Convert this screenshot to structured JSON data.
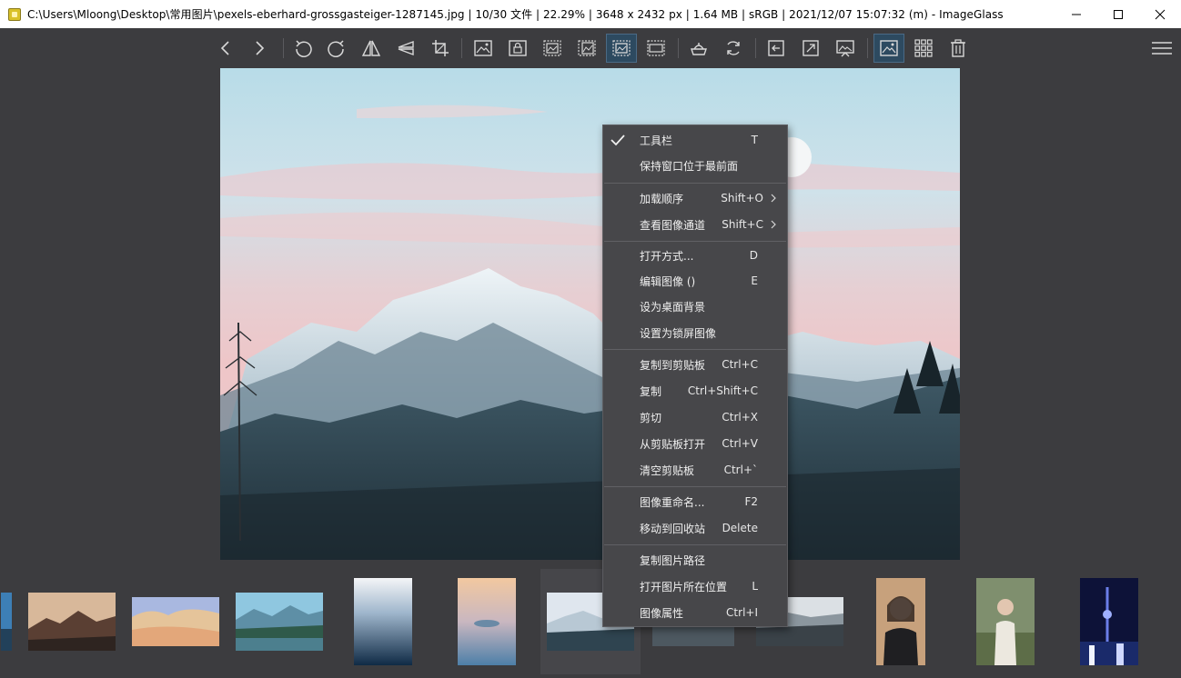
{
  "window": {
    "title": "C:\\Users\\Mloong\\Desktop\\常用图片\\pexels-eberhard-grossgasteiger-1287145.jpg  |  10/30 文件  |  22.29%  |  3648 x 2432 px  |  1.64 MB  |  sRGB  |  2021/12/07 15:07:32 (m)  - ImageGlass"
  },
  "toolbar": {
    "icons": [
      "prev-icon",
      "next-icon",
      "rotate-left-icon",
      "rotate-right-icon",
      "flip-horizontal-icon",
      "flip-vertical-icon",
      "crop-icon",
      "auto-zoom-icon",
      "lock-zoom-icon",
      "scale-to-width-icon",
      "scale-to-height-icon",
      "scale-to-fit-icon",
      "scale-to-fill-icon",
      "checkerboard-icon",
      "refresh-icon",
      "fullscreen-icon",
      "window-fit-icon",
      "slideshow-icon",
      "viewer-icon",
      "gallery-icon",
      "trash-icon",
      "menu-icon"
    ],
    "active": [
      "scale-to-fit-icon",
      "viewer-icon"
    ],
    "accent_color": "#2d4a60"
  },
  "context_menu": {
    "items": [
      {
        "label": "工具栏",
        "shortcut": "T",
        "checked": true
      },
      {
        "label": "保持窗口位于最前面",
        "shortcut": ""
      },
      {
        "label": "加载顺序",
        "shortcut": "Shift+O",
        "submenu": true
      },
      {
        "label": "查看图像通道",
        "shortcut": "Shift+C",
        "submenu": true
      },
      {
        "label": "打开方式...",
        "shortcut": "D"
      },
      {
        "label": "编辑图像 ()",
        "shortcut": "E"
      },
      {
        "label": "设为桌面背景",
        "shortcut": ""
      },
      {
        "label": "设置为锁屏图像",
        "shortcut": ""
      },
      {
        "label": "复制到剪贴板",
        "shortcut": "Ctrl+C"
      },
      {
        "label": "复制",
        "shortcut": "Ctrl+Shift+C"
      },
      {
        "label": "剪切",
        "shortcut": "Ctrl+X"
      },
      {
        "label": "从剪贴板打开",
        "shortcut": "Ctrl+V"
      },
      {
        "label": "清空剪贴板",
        "shortcut": "Ctrl+`"
      },
      {
        "label": "图像重命名...",
        "shortcut": "F2"
      },
      {
        "label": "移动到回收站",
        "shortcut": "Delete"
      },
      {
        "label": "复制图片路径",
        "shortcut": ""
      },
      {
        "label": "打开图片所在位置",
        "shortcut": "L"
      },
      {
        "label": "图像属性",
        "shortcut": "Ctrl+I"
      }
    ]
  },
  "thumbnails": {
    "count": 11,
    "selected_index": 5
  }
}
